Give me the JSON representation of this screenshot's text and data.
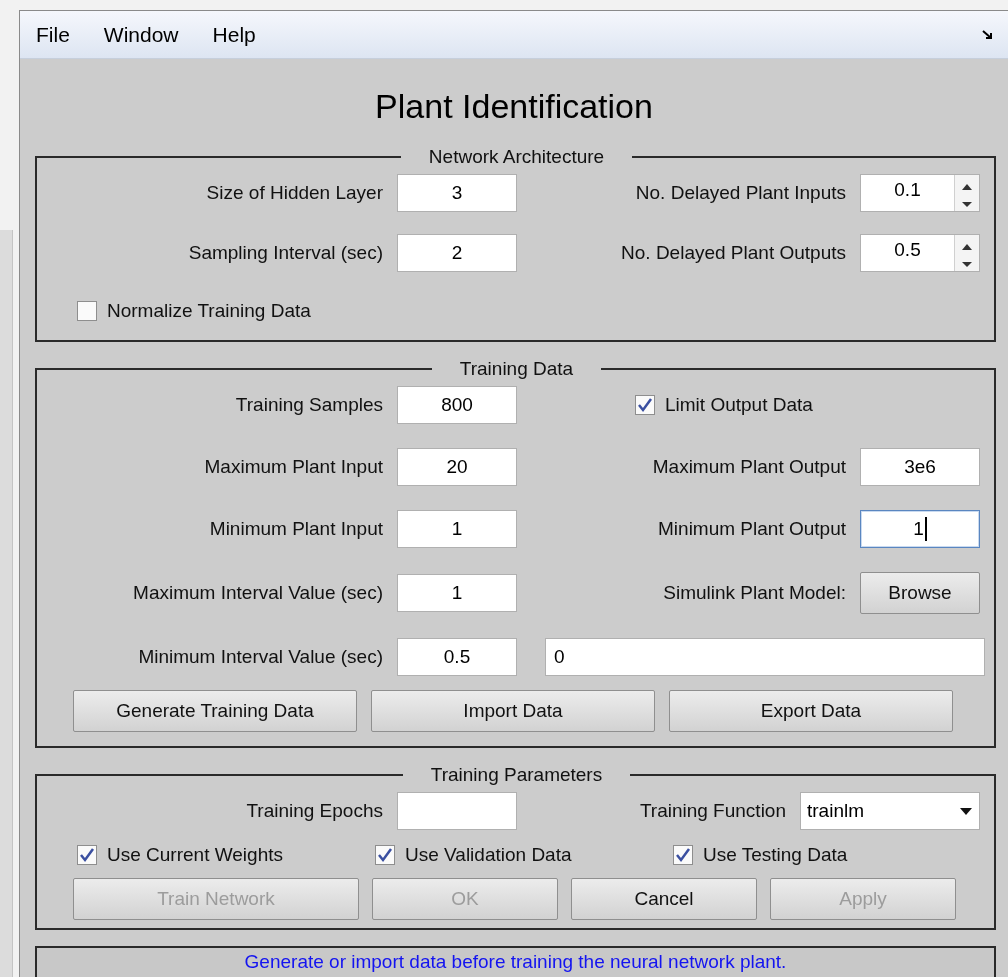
{
  "menu": [
    "File",
    "Window",
    "Help"
  ],
  "title": "Plant Identification",
  "network_architecture": {
    "legend": "Network Architecture",
    "left": [
      {
        "label": "Size of Hidden Layer",
        "value": "3"
      },
      {
        "label": "Sampling Interval (sec)",
        "value": "2"
      }
    ],
    "right": [
      {
        "label": "No. Delayed Plant Inputs",
        "value": "0.1"
      },
      {
        "label": "No. Delayed Plant Outputs",
        "value": "0.5"
      }
    ],
    "normalize": {
      "label": "Normalize Training Data",
      "checked": false
    }
  },
  "training_data": {
    "legend": "Training Data",
    "left": [
      {
        "label": "Training Samples",
        "value": "800"
      },
      {
        "label": "Maximum Plant Input",
        "value": "20"
      },
      {
        "label": "Minimum Plant Input",
        "value": "1"
      },
      {
        "label": "Maximum Interval Value (sec)",
        "value": "1"
      },
      {
        "label": "Minimum Interval Value (sec)",
        "value": "0.5"
      }
    ],
    "limit": {
      "label": "Limit Output Data",
      "checked": true
    },
    "right": [
      {
        "label": "Maximum Plant Output",
        "value": "3e6",
        "focused": false
      },
      {
        "label": "Minimum Plant Output",
        "value": "1",
        "focused": true
      }
    ],
    "model": {
      "label": "Simulink Plant Model:",
      "button": "Browse"
    },
    "path": "0",
    "buttons": [
      "Generate Training Data",
      "Import Data",
      "Export Data"
    ]
  },
  "training_parameters": {
    "legend": "Training Parameters",
    "epochs": {
      "label": "Training Epochs"
    },
    "function": {
      "label": "Training Function",
      "value": "trainlm"
    },
    "checks": [
      {
        "label": "Use Current Weights",
        "checked": true
      },
      {
        "label": "Use Validation Data",
        "checked": true
      },
      {
        "label": "Use Testing Data",
        "checked": true
      }
    ],
    "buttons": [
      {
        "label": "Train Network",
        "disabled": true
      },
      {
        "label": "OK",
        "disabled": true
      },
      {
        "label": "Cancel",
        "disabled": false
      },
      {
        "label": "Apply",
        "disabled": true
      }
    ]
  },
  "status": "Generate or import data before training the neural network plant."
}
